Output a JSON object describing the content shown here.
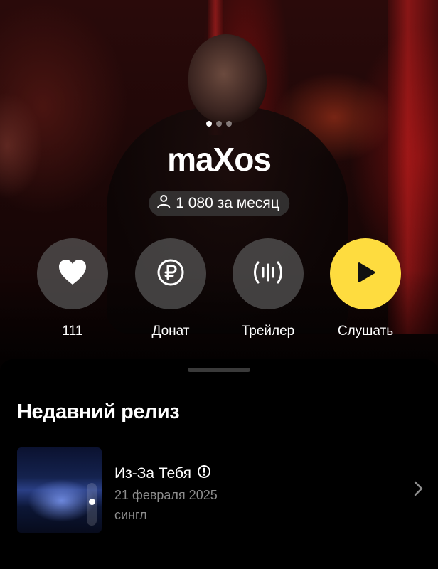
{
  "artist": {
    "name": "maXos",
    "monthly_listeners": "1 080 за месяц",
    "photo_carousel": {
      "count": 3,
      "active": 1
    }
  },
  "actions": {
    "like": {
      "icon": "heart-icon",
      "label": "111"
    },
    "donate": {
      "icon": "ruble-icon",
      "label": "Донат"
    },
    "trailer": {
      "icon": "soundwave-icon",
      "label": "Трейлер"
    },
    "listen": {
      "icon": "play-icon",
      "label": "Слушать"
    }
  },
  "recent_release": {
    "section_title": "Недавний релиз",
    "title": "Из-За Тебя",
    "explicit_icon": "info-circle-icon",
    "date": "21 февраля 2025",
    "type": "сингл"
  },
  "colors": {
    "accent_yellow": "#fedc3f",
    "background": "#000000",
    "secondary_text": "#8d8d8d"
  }
}
